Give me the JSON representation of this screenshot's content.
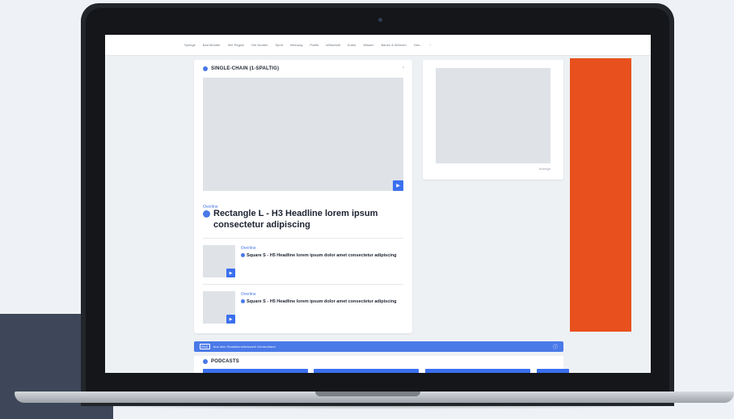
{
  "nav": {
    "items": [
      "Springe",
      "Bad Münder",
      "Ihre Region",
      "Die Norden",
      "Sport",
      "Meinung",
      "Politik",
      "Wirtschaft",
      "Kultur",
      "Wissen",
      "Bauen & Wohnen",
      "Ges..."
    ],
    "chevron": "›"
  },
  "main_card": {
    "section_title": "SINGLE-CHAIN (1-SPALTIG)",
    "section_arrow": "›",
    "hero": {
      "overline": "Overline",
      "headline": "Rectangle L - H3 Headline lorem ipsum consectetur adipiscing",
      "play_icon": "play-icon"
    },
    "articles": [
      {
        "overline": "Overline",
        "headline": "Square S - H5 Headline lorem ipsum dolor amet consectetur adipiscing"
      },
      {
        "overline": "Overline",
        "headline": "Square S - H5 Headline lorem ipsum dolor amet consectetur adipiscing"
      }
    ]
  },
  "side_card": {
    "ad_label": "Anzeige"
  },
  "network_bar": {
    "logo": "RND",
    "text": "Aus dem RedaktionsNetzwerk Deutschland"
  },
  "podcasts": {
    "title": "PODCASTS"
  },
  "colors": {
    "accent": "#4a79e8",
    "orange_ad": "#e8501e",
    "laptop_frame": "#22252a",
    "page_bg": "#eef2f6"
  }
}
